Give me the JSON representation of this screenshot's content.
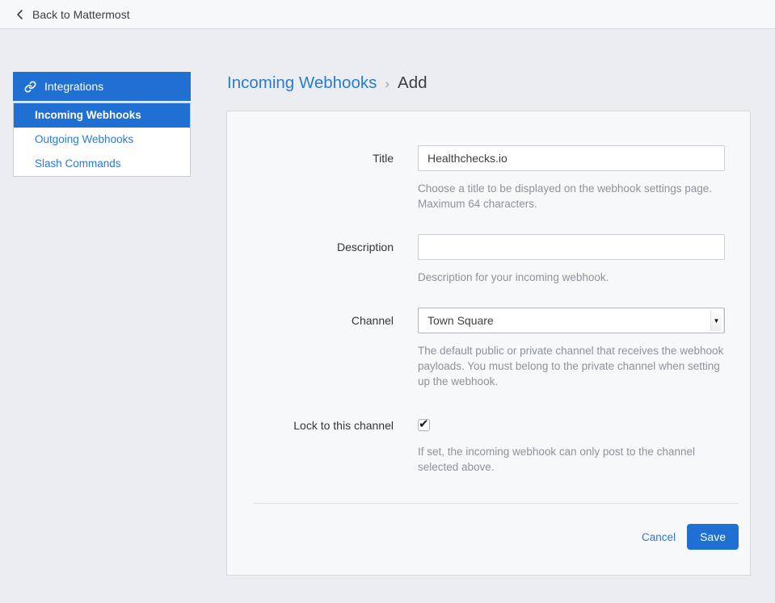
{
  "colors": {
    "primary": "#1f70d2",
    "link": "#2a7ad6",
    "page_background": "#ebedf0",
    "panel_background": "#f7f8fa",
    "help_text": "#8d939c"
  },
  "topbar": {
    "back_label": "Back to Mattermost"
  },
  "sidebar": {
    "header": {
      "label": "Integrations",
      "icon": "link-icon"
    },
    "items": [
      {
        "label": "Incoming Webhooks",
        "active": true
      },
      {
        "label": "Outgoing Webhooks",
        "active": false
      },
      {
        "label": "Slash Commands",
        "active": false
      }
    ]
  },
  "breadcrumb": {
    "parent": "Incoming Webhooks",
    "separator": "›",
    "current": "Add"
  },
  "form": {
    "title": {
      "label": "Title",
      "value": "Healthchecks.io",
      "help": "Choose a title to be displayed on the webhook settings page. Maximum 64 characters."
    },
    "description": {
      "label": "Description",
      "value": "",
      "help": "Description for your incoming webhook."
    },
    "channel": {
      "label": "Channel",
      "selected_option": "Town Square",
      "help": "The default public or private channel that receives the webhook payloads. You must belong to the private channel when setting up the webhook."
    },
    "lock": {
      "label": "Lock to this channel",
      "checked": true,
      "check_glyph": "✔",
      "help": "If set, the incoming webhook can only post to the channel selected above."
    },
    "footer": {
      "cancel_label": "Cancel",
      "save_label": "Save"
    }
  }
}
